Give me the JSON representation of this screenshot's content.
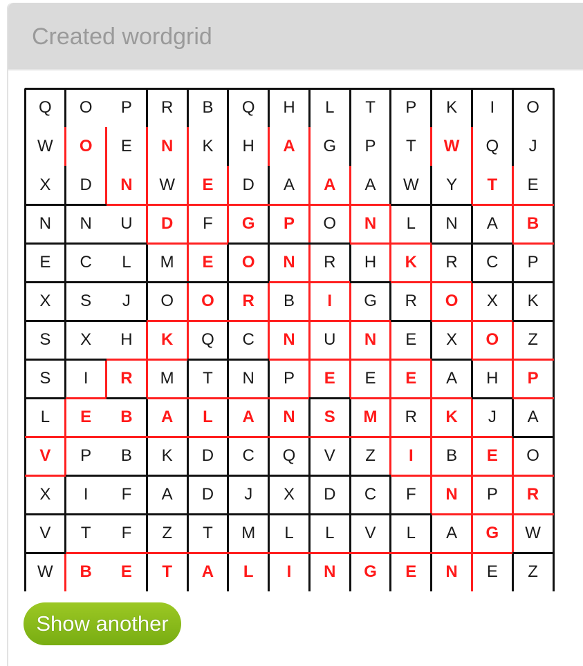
{
  "panel": {
    "title": "Created wordgrid"
  },
  "grid": {
    "rows": 13,
    "cols": 13,
    "letters": [
      [
        "Q",
        "O",
        "P",
        "R",
        "B",
        "Q",
        "H",
        "L",
        "T",
        "P",
        "K",
        "I",
        "O"
      ],
      [
        "W",
        "O",
        "E",
        "N",
        "K",
        "H",
        "A",
        "G",
        "P",
        "T",
        "W",
        "Q",
        "J"
      ],
      [
        "X",
        "D",
        "N",
        "W",
        "E",
        "D",
        "A",
        "A",
        "A",
        "W",
        "Y",
        "T",
        "E"
      ],
      [
        "N",
        "N",
        "U",
        "D",
        "F",
        "G",
        "P",
        "O",
        "N",
        "L",
        "N",
        "A",
        "B"
      ],
      [
        "E",
        "C",
        "L",
        "M",
        "E",
        "O",
        "N",
        "R",
        "H",
        "K",
        "R",
        "C",
        "P"
      ],
      [
        "X",
        "S",
        "J",
        "O",
        "O",
        "R",
        "B",
        "I",
        "G",
        "R",
        "O",
        "X",
        "K"
      ],
      [
        "S",
        "X",
        "H",
        "K",
        "Q",
        "C",
        "N",
        "U",
        "N",
        "E",
        "X",
        "O",
        "Z"
      ],
      [
        "S",
        "I",
        "R",
        "M",
        "T",
        "N",
        "P",
        "E",
        "E",
        "E",
        "A",
        "H",
        "P"
      ],
      [
        "L",
        "E",
        "B",
        "A",
        "L",
        "A",
        "N",
        "S",
        "M",
        "R",
        "K",
        "J",
        "A"
      ],
      [
        "V",
        "P",
        "B",
        "K",
        "D",
        "C",
        "Q",
        "V",
        "Z",
        "I",
        "B",
        "E",
        "O"
      ],
      [
        "X",
        "I",
        "F",
        "A",
        "D",
        "J",
        "X",
        "D",
        "C",
        "F",
        "N",
        "P",
        "R"
      ],
      [
        "V",
        "T",
        "F",
        "Z",
        "T",
        "M",
        "L",
        "L",
        "V",
        "L",
        "A",
        "G",
        "W"
      ],
      [
        "W",
        "B",
        "E",
        "T",
        "A",
        "L",
        "I",
        "N",
        "G",
        "E",
        "N",
        "E",
        "Z"
      ]
    ],
    "highlighted": [
      [
        0,
        0,
        0,
        0,
        0,
        0,
        0,
        0,
        0,
        0,
        0,
        0,
        0
      ],
      [
        0,
        1,
        0,
        1,
        0,
        0,
        1,
        0,
        0,
        0,
        1,
        0,
        0
      ],
      [
        0,
        0,
        1,
        0,
        1,
        0,
        0,
        1,
        0,
        0,
        0,
        1,
        0
      ],
      [
        0,
        0,
        0,
        1,
        0,
        1,
        1,
        0,
        1,
        0,
        0,
        0,
        1
      ],
      [
        0,
        0,
        0,
        0,
        1,
        1,
        1,
        0,
        0,
        1,
        0,
        0,
        0
      ],
      [
        0,
        0,
        0,
        0,
        1,
        1,
        0,
        1,
        0,
        0,
        1,
        0,
        0
      ],
      [
        0,
        0,
        0,
        1,
        0,
        0,
        1,
        0,
        1,
        0,
        0,
        1,
        0
      ],
      [
        0,
        0,
        1,
        0,
        0,
        0,
        0,
        1,
        0,
        1,
        0,
        0,
        1
      ],
      [
        0,
        1,
        1,
        1,
        1,
        1,
        1,
        1,
        1,
        0,
        1,
        0,
        0
      ],
      [
        1,
        0,
        0,
        0,
        0,
        0,
        0,
        0,
        0,
        1,
        0,
        1,
        0
      ],
      [
        0,
        0,
        0,
        0,
        0,
        0,
        0,
        0,
        0,
        0,
        1,
        0,
        1
      ],
      [
        0,
        0,
        0,
        0,
        0,
        0,
        0,
        0,
        0,
        0,
        0,
        1,
        0
      ],
      [
        0,
        1,
        1,
        1,
        1,
        1,
        1,
        1,
        1,
        1,
        1,
        0,
        0
      ]
    ],
    "colors": {
      "letter": "#1a1a1a",
      "highlight": "#ff1a1a",
      "line": "#111111",
      "highlight_line": "#ff2020"
    }
  },
  "actions": {
    "show_another_label": "Show another"
  }
}
